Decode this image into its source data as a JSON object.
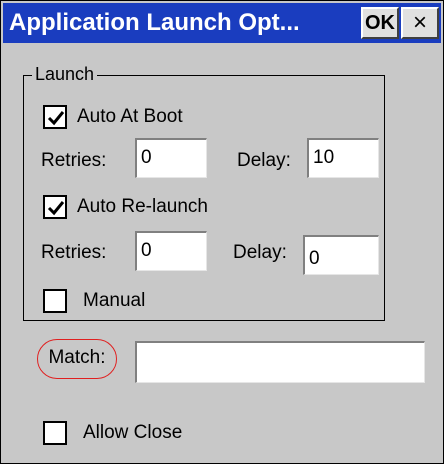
{
  "window": {
    "title": "Application Launch Opt...",
    "ok_label": "OK",
    "close_label": "×"
  },
  "launch": {
    "group_label": "Launch",
    "auto_at_boot": {
      "label": "Auto At Boot",
      "checked": true,
      "retries_label": "Retries:",
      "retries_value": "0",
      "delay_label": "Delay:",
      "delay_value": "10"
    },
    "auto_relaunch": {
      "label": "Auto Re-launch",
      "checked": true,
      "retries_label": "Retries:",
      "retries_value": "0",
      "delay_label": "Delay:",
      "delay_value": "0"
    },
    "manual": {
      "label": "Manual",
      "checked": false
    }
  },
  "match": {
    "label": "Match:",
    "value": "",
    "highlight_color": "#e02020"
  },
  "allow_close": {
    "label": "Allow Close",
    "checked": false
  },
  "colors": {
    "titlebar": "#1a3dbf",
    "background": "#c8c8c8"
  }
}
